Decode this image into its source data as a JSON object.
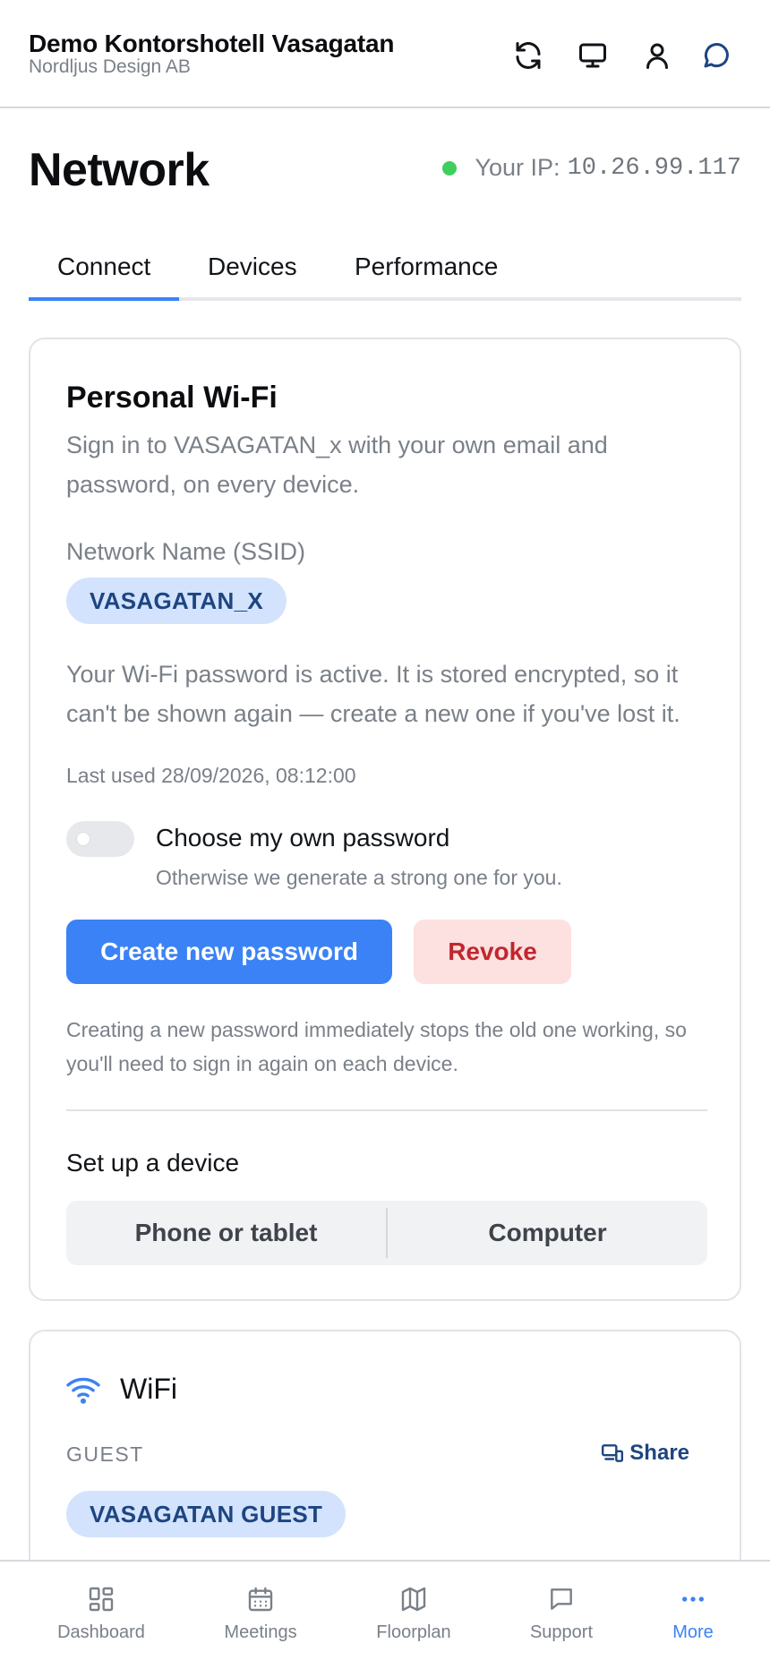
{
  "header": {
    "title": "Demo Kontorshotell Vasagatan",
    "subtitle": "Nordljus Design AB",
    "icons": [
      "refresh-icon",
      "monitor-icon",
      "user-icon",
      "chat-icon"
    ]
  },
  "page": {
    "title": "Network",
    "ip_label": "Your IP:",
    "ip_value": "10.26.99.117",
    "ip_status_color": "#3ecf5e"
  },
  "tabs": [
    {
      "label": "Connect",
      "active": true
    },
    {
      "label": "Devices",
      "active": false
    },
    {
      "label": "Performance",
      "active": false
    }
  ],
  "personal_wifi": {
    "title": "Personal Wi-Fi",
    "description": "Sign in to VASAGATAN_x with your own email and password, on every device.",
    "ssid_label": "Network Name (SSID)",
    "ssid": "VASAGATAN_X",
    "status": "Your Wi-Fi password is active. It is stored encrypted, so it can't be shown again — create a new one if you've lost it.",
    "last_used": "Last used 28/09/2026, 08:12:00",
    "toggle_label": "Choose my own password",
    "toggle_help": "Otherwise we generate a strong one for you.",
    "toggle_on": false,
    "create_button": "Create new password",
    "revoke_button": "Revoke",
    "note": "Creating a new password immediately stops the old one working, so you'll need to sign in again on each device.",
    "setup_title": "Set up a device",
    "setup_options": [
      "Phone or tablet",
      "Computer"
    ]
  },
  "wifi": {
    "title": "WiFi",
    "guest_label": "GUEST",
    "share_label": "Share",
    "guest_ssid": "VASAGATAN GUEST"
  },
  "bottom_nav": [
    {
      "label": "Dashboard",
      "icon": "dashboard-icon",
      "active": false
    },
    {
      "label": "Meetings",
      "icon": "calendar-icon",
      "active": false
    },
    {
      "label": "Floorplan",
      "icon": "map-icon",
      "active": false
    },
    {
      "label": "Support",
      "icon": "chat-icon",
      "active": false
    },
    {
      "label": "More",
      "icon": "more-icon",
      "active": true
    }
  ],
  "colors": {
    "accent": "#3b82f6",
    "danger": "#c0272d",
    "pill_bg": "#d3e3fd",
    "pill_text": "#1d4580"
  }
}
